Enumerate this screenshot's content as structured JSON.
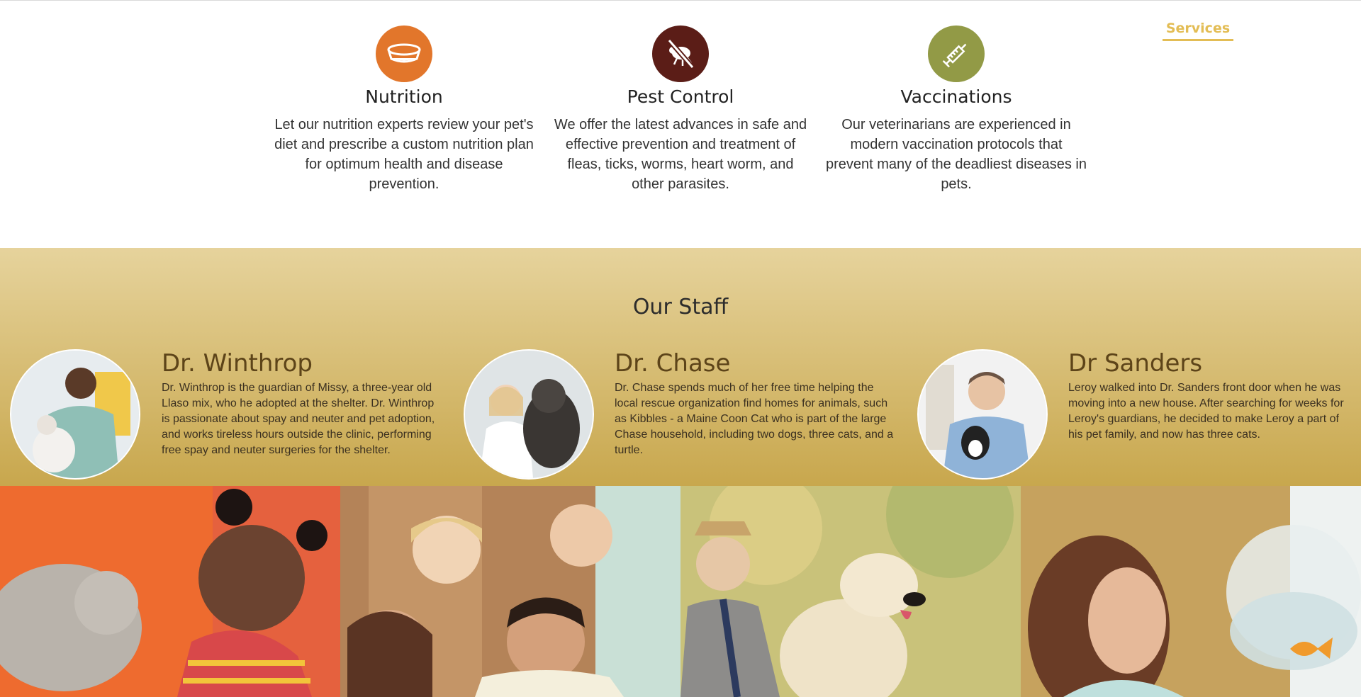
{
  "nav": {
    "services_label": "Services"
  },
  "services": [
    {
      "icon": "food-bowl-icon",
      "color": "#e2762b",
      "title": "Nutrition",
      "description": "Let our nutrition experts review your pet's diet and prescribe a custom nutrition plan for optimum health and disease prevention."
    },
    {
      "icon": "no-flea-icon",
      "color": "#5b1d17",
      "title": "Pest Control",
      "description": "We offer the latest advances in safe and effective prevention and treatment of fleas, ticks, worms, heart worm, and other parasites."
    },
    {
      "icon": "syringe-icon",
      "color": "#929a46",
      "title": "Vaccinations",
      "description": "Our veterinarians are experienced in modern vaccination protocols that prevent many of the deadliest diseases in pets."
    }
  ],
  "staff": {
    "title": "Our Staff",
    "members": [
      {
        "name": "Dr. Winthrop",
        "bio": "Dr. Winthrop is the guardian of Missy, a three-year old Llaso mix, who he adopted at the shelter. Dr. Winthrop is passionate about spay and neuter and pet adoption, and works tireless hours outside the clinic, performing free spay and neuter surgeries for the shelter."
      },
      {
        "name": "Dr. Chase",
        "bio": "Dr. Chase spends much of her free time helping the local rescue organization find homes for animals, such as Kibbles - a Maine Coon Cat who is part of the large Chase household, including two dogs, three cats, and a turtle."
      },
      {
        "name": "Dr Sanders",
        "bio": "Leroy walked into Dr. Sanders front door when he was moving into a new house. After searching for weeks for Leroy's guardians, he decided to make Leroy a part of his pet family, and now has three cats."
      }
    ]
  },
  "colors": {
    "accent": "#e3bd55",
    "name_brown": "#5d4419"
  }
}
